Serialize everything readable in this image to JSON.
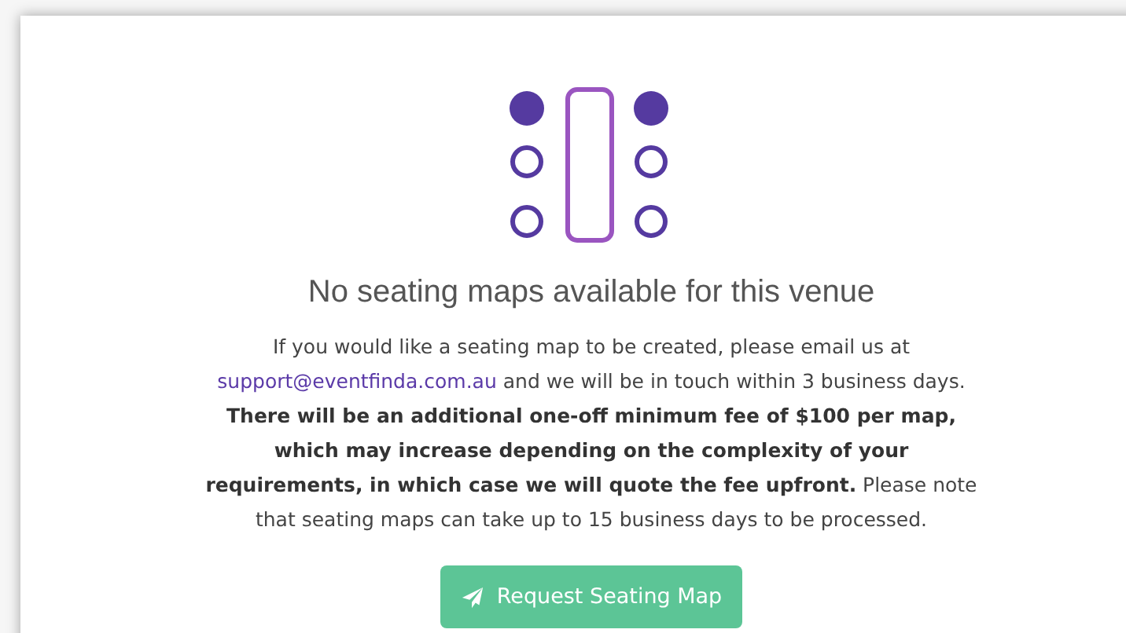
{
  "empty_state": {
    "title": "No seating maps available for this venue",
    "message": {
      "before": "If you would like a seating map to be created, please email us at",
      "email": "support@eventfinda.com.au",
      "after": "and we will be in touch within 3 business days. **There will be an additional one-off minimum fee of $100 per map, which may increase depending on the complexity of your requirements, in which case we will quote the fee upfront.** Please note that seating maps can take up to 15 business days to be processed."
    },
    "button": {
      "label": "Request Seating Map"
    }
  }
}
